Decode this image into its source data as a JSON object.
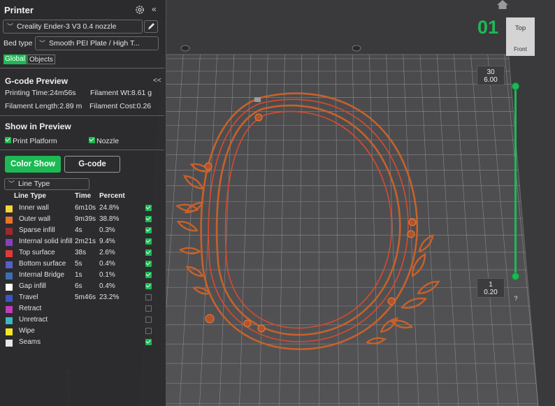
{
  "panel": {
    "title": "Printer",
    "collapse_label": "«",
    "printer_name": "Creality Ender-3 V3 0.4 nozzle",
    "bed_type_label": "Bed type",
    "bed_type_value": "Smooth PEI Plate / High T...",
    "tabs": [
      {
        "label": "Global",
        "active": true
      },
      {
        "label": "Objects",
        "active": false
      }
    ]
  },
  "gcode_preview": {
    "title": "G-code Preview",
    "collapse_label": "<<",
    "printing_time": "Printing Time:24m56s",
    "filament_wt": "Filament Wt:8.61 g",
    "filament_length": "Filament Length:2.89 m",
    "filament_cost": "Filament Cost:0.26"
  },
  "show_in_preview": {
    "title": "Show in Preview",
    "print_platform": {
      "label": "Print Platform",
      "checked": true
    },
    "nozzle": {
      "label": "Nozzle",
      "checked": true
    }
  },
  "buttons": {
    "color_show": "Color Show",
    "gcode": "G-code"
  },
  "line_type_select": "Line Type",
  "table": {
    "headers": [
      "Line Type",
      "Time",
      "Percent"
    ],
    "rows": [
      {
        "name": "Inner wall",
        "time": "6m10s",
        "percent": "24.8%",
        "color": "#f5d33a",
        "visible": true
      },
      {
        "name": "Outer wall",
        "time": "9m39s",
        "percent": "38.8%",
        "color": "#e8742b",
        "visible": true
      },
      {
        "name": "Sparse infill",
        "time": "4s",
        "percent": "0.3%",
        "color": "#9c2a2a",
        "visible": true
      },
      {
        "name": "Internal solid infill",
        "time": "2m21s",
        "percent": "9.4%",
        "color": "#8a3fbd",
        "visible": true
      },
      {
        "name": "Top surface",
        "time": "38s",
        "percent": "2.6%",
        "color": "#e03a3a",
        "visible": true
      },
      {
        "name": "Bottom surface",
        "time": "5s",
        "percent": "0.4%",
        "color": "#5560c8",
        "visible": true
      },
      {
        "name": "Internal Bridge",
        "time": "1s",
        "percent": "0.1%",
        "color": "#3c6fb0",
        "visible": true
      },
      {
        "name": "Gap infill",
        "time": "6s",
        "percent": "0.4%",
        "color": "#ffffff",
        "visible": true
      },
      {
        "name": "Travel",
        "time": "5m46s",
        "percent": "23.2%",
        "color": "#3a56c4",
        "visible": false
      },
      {
        "name": "Retract",
        "time": "",
        "percent": "",
        "color": "#c43ac0",
        "visible": false
      },
      {
        "name": "Unretract",
        "time": "",
        "percent": "",
        "color": "#3ab8c4",
        "visible": false
      },
      {
        "name": "Wipe",
        "time": "",
        "percent": "",
        "color": "#f5e52a",
        "visible": false
      },
      {
        "name": "Seams",
        "time": "",
        "percent": "",
        "color": "#e8e8e8",
        "visible": true
      }
    ]
  },
  "layer_view": {
    "plate_number": "01",
    "view_top": "Top",
    "view_front": "Front",
    "top_layer": "30",
    "top_height": "6.00",
    "bottom_layer": "1",
    "bottom_height": "0.20",
    "help": "?"
  },
  "colors": {
    "accent": "#1db954",
    "model": "#c8612a"
  }
}
